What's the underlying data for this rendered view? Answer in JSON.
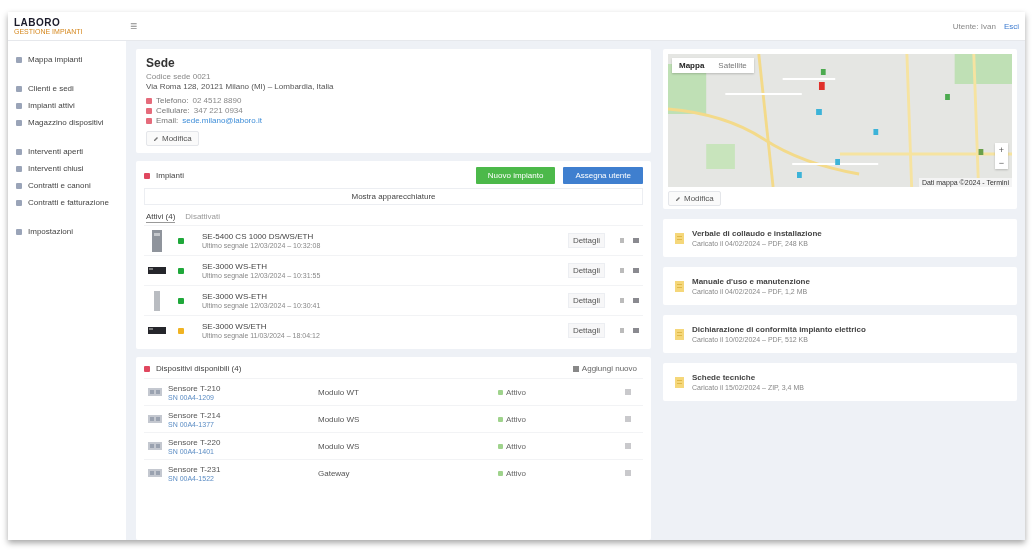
{
  "header": {
    "logo": "LABORO",
    "logo_sub": "GESTIONE IMPIANTI",
    "menu_glyph": "≡",
    "user": "Utente: Ivan",
    "logout": "Esci"
  },
  "sidebar": {
    "items": [
      {
        "label": "Mappa impianti",
        "selected": false
      },
      {
        "label": "Clienti e sedi",
        "selected": false
      },
      {
        "label": "Impianti attivi",
        "selected": false
      },
      {
        "label": "Magazzino dispositivi",
        "selected": false
      },
      {
        "label": "Interventi aperti",
        "selected": false
      },
      {
        "label": "Interventi chiusi",
        "selected": false
      },
      {
        "label": "Contratti e canoni",
        "selected": false
      },
      {
        "label": "Contratti e fatturazione",
        "selected": false
      },
      {
        "label": "Impostazioni",
        "selected": false
      }
    ]
  },
  "site": {
    "title": "Sede",
    "code": "Codice sede 0021",
    "address": "Via Roma 128, 20121 Milano (MI) – Lombardia, Italia",
    "contacts": [
      {
        "label": "Telefono:",
        "value": "02 4512 8890",
        "link": false
      },
      {
        "label": "Cellulare:",
        "value": "347 221 0934",
        "link": false
      },
      {
        "label": "Email:",
        "value": "sede.milano@laboro.it",
        "link": true
      }
    ],
    "edit_button": "Modifica"
  },
  "plants": {
    "title": "Impianti",
    "add_button": "Nuovo impianto",
    "assign_button": "Assegna utente",
    "show_bar": "Mostra apparecchiature",
    "tabs": [
      {
        "label": "Attivi (4)",
        "selected": true
      },
      {
        "label": "Disattivati",
        "selected": false
      }
    ],
    "rows": [
      {
        "kind": "tower",
        "color": "#1fa83a",
        "name": "SE-5400 CS 1000 DS/WS/ETH",
        "sub": "Ultimo segnale 12/03/2024 – 10:32:08",
        "details": "Dettagli"
      },
      {
        "kind": "rack",
        "color": "#1fa83a",
        "name": "SE-3000 WS-ETH",
        "sub": "Ultimo segnale 12/03/2024 – 10:31:55",
        "details": "Dettagli"
      },
      {
        "kind": "slim",
        "color": "#1fa83a",
        "name": "SE-3000 WS-ETH",
        "sub": "Ultimo segnale 12/03/2024 – 10:30:41",
        "details": "Dettagli"
      },
      {
        "kind": "rack",
        "color": "#f0b323",
        "name": "SE-3000 WS/ETH",
        "sub": "Ultimo segnale 11/03/2024 – 18:04:12",
        "details": "Dettagli"
      }
    ]
  },
  "devices": {
    "title": "Dispositivi disponibili (4)",
    "add_link": "Aggiungi nuovo",
    "rows": [
      {
        "name": "Sensore T-210",
        "sub": "SN 00A4-1209",
        "model": "Modulo WT",
        "status": "Attivo"
      },
      {
        "name": "Sensore T-214",
        "sub": "SN 00A4-1377",
        "model": "Modulo WS",
        "status": "Attivo"
      },
      {
        "name": "Sensore T-220",
        "sub": "SN 00A4-1401",
        "model": "Modulo WS",
        "status": "Attivo"
      },
      {
        "name": "Sensore T-231",
        "sub": "SN 00A4-1522",
        "model": "Gateway",
        "status": "Attivo"
      }
    ]
  },
  "map": {
    "tabs": [
      {
        "label": "Mappa",
        "selected": true
      },
      {
        "label": "Satellite",
        "selected": false
      }
    ],
    "zoom_in": "+",
    "zoom_out": "−",
    "attribution": "Dati mappa ©2024 - Termini",
    "edit_button": "Modifica"
  },
  "documents": [
    {
      "title": "Verbale di collaudo e installazione",
      "sub": "Caricato il 04/02/2024 – PDF, 248 KB"
    },
    {
      "title": "Manuale d'uso e manutenzione",
      "sub": "Caricato il 04/02/2024 – PDF, 1,2 MB"
    },
    {
      "title": "Dichiarazione di conformità impianto elettrico",
      "sub": "Caricato il 10/02/2024 – PDF, 512 KB"
    },
    {
      "title": "Schede tecniche",
      "sub": "Caricato il 15/02/2024 – ZIP, 3,4 MB"
    }
  ]
}
